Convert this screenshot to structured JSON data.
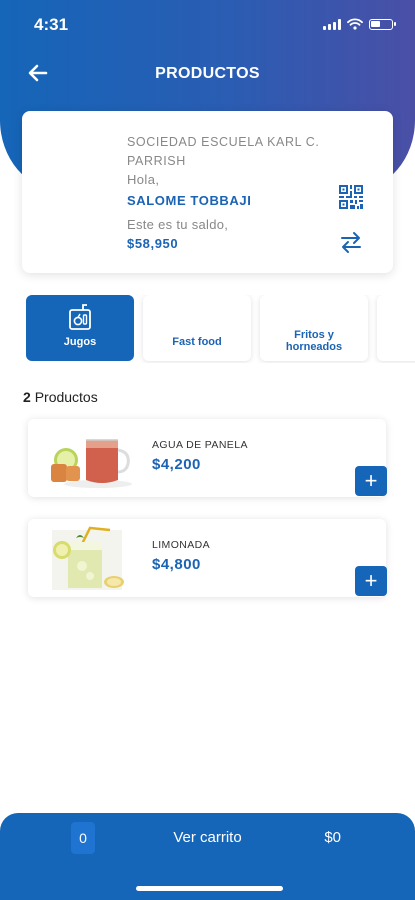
{
  "status_bar": {
    "time": "4:31"
  },
  "header": {
    "title": "PRODUCTOS"
  },
  "account": {
    "school": "SOCIEDAD ESCUELA KARL C. PARRISH",
    "greeting": "Hola,",
    "user_name": "SALOME TOBBAJI",
    "balance_label": "Este es tu saldo,",
    "balance": "$58,950"
  },
  "categories": [
    {
      "label": "Jugos",
      "active": true
    },
    {
      "label": "Fast food",
      "active": false
    },
    {
      "label": "Fritos y horneados",
      "active": false
    }
  ],
  "products_count": {
    "count": "2",
    "label": "Productos"
  },
  "products": [
    {
      "name": "AGUA DE PANELA",
      "price": "$4,200",
      "icon": "agua-de-panela-image"
    },
    {
      "name": "LIMONADA",
      "price": "$4,800",
      "icon": "limonada-image"
    }
  ],
  "cart": {
    "count": "0",
    "label": "Ver carrito",
    "total": "$0"
  },
  "colors": {
    "primary": "#1565b8",
    "accent_text": "#1b63b4",
    "gradient_end": "#4a4fa6"
  }
}
